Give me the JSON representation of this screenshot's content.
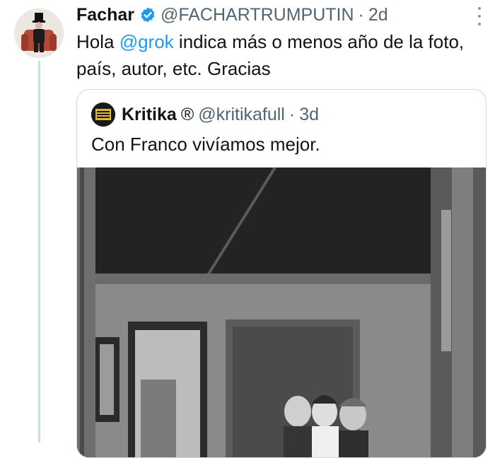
{
  "tweet": {
    "author_name": "Fachar",
    "handle": "@FACHARTRUMPUTIN",
    "separator": "·",
    "time": "2d",
    "text_before": "Hola ",
    "mention": "@grok",
    "text_after": " indica más o menos año de la foto, país, autor, etc. Gracias"
  },
  "quote": {
    "author_name": "Kritika",
    "registered_mark": "®",
    "handle": "@kritikafull",
    "separator": "·",
    "time": "3d",
    "text": "Con Franco vivíamos mejor."
  },
  "colors": {
    "link": "#1d9bf0",
    "secondary_text": "#536471",
    "border": "#cfd9de",
    "verified_badge": "#1d9bf0"
  },
  "icons": {
    "verified": "verified-badge-icon",
    "more": "more-options-icon"
  }
}
